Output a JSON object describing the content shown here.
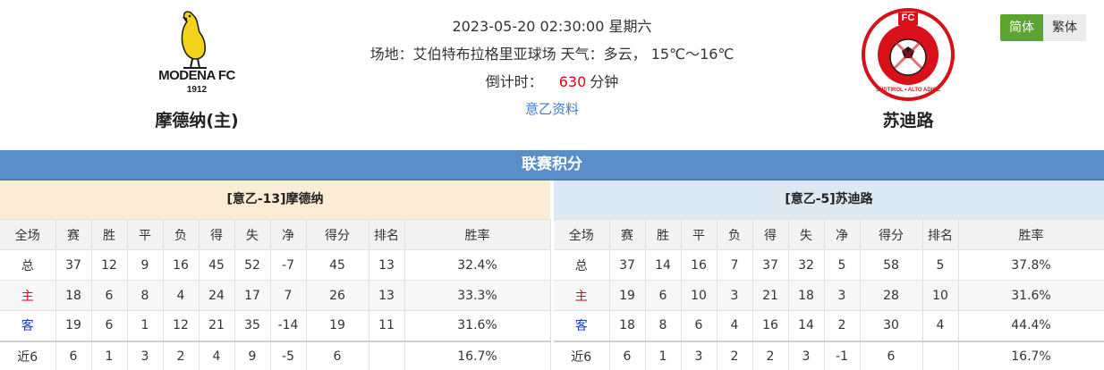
{
  "match": {
    "datetime": "2023-05-20 02:30:00 星期六",
    "venue_line": "场地：艾伯特布拉格里亚球场 天气：多云， 15℃～16℃",
    "countdown_label": "倒计时：",
    "countdown_value": "630",
    "countdown_unit": "分钟",
    "league_link": "意乙资料"
  },
  "home_team": {
    "name": "摩德纳(主)",
    "logo_text": "MODENA FC",
    "logo_year": "1912"
  },
  "away_team": {
    "name": "苏迪路",
    "logo_text_top": "FC",
    "logo_text_ring": "SÜDTIROL • ALTO ADIGE"
  },
  "lang": {
    "simplified": "简体",
    "traditional": "繁体"
  },
  "section_title": "联赛积分",
  "columns": [
    "全场",
    "赛",
    "胜",
    "平",
    "负",
    "得",
    "失",
    "净",
    "得分",
    "排名",
    "胜率"
  ],
  "home_standing": {
    "title": "[意乙-13]摩德纳",
    "rows": [
      [
        "总",
        "37",
        "12",
        "9",
        "16",
        "45",
        "52",
        "-7",
        "45",
        "13",
        "32.4%"
      ],
      [
        "主",
        "18",
        "6",
        "8",
        "4",
        "24",
        "17",
        "7",
        "26",
        "13",
        "33.3%"
      ],
      [
        "客",
        "19",
        "6",
        "1",
        "12",
        "21",
        "35",
        "-14",
        "19",
        "11",
        "31.6%"
      ],
      [
        "近6",
        "6",
        "1",
        "3",
        "2",
        "4",
        "9",
        "-5",
        "6",
        "",
        "16.7%"
      ]
    ]
  },
  "away_standing": {
    "title": "[意乙-5]苏迪路",
    "rows": [
      [
        "总",
        "37",
        "14",
        "16",
        "7",
        "37",
        "32",
        "5",
        "58",
        "5",
        "37.8%"
      ],
      [
        "主",
        "19",
        "6",
        "10",
        "3",
        "21",
        "18",
        "3",
        "28",
        "10",
        "31.6%"
      ],
      [
        "客",
        "18",
        "8",
        "6",
        "4",
        "16",
        "14",
        "2",
        "30",
        "4",
        "44.4%"
      ],
      [
        "近6",
        "6",
        "1",
        "3",
        "2",
        "2",
        "3",
        "-1",
        "6",
        "",
        "16.7%"
      ]
    ]
  },
  "colors": {
    "accent_bar": "#5a8ec9",
    "home_label": "#e60012",
    "away_label": "#1a3fb0",
    "lang_active": "#5aa52e"
  }
}
